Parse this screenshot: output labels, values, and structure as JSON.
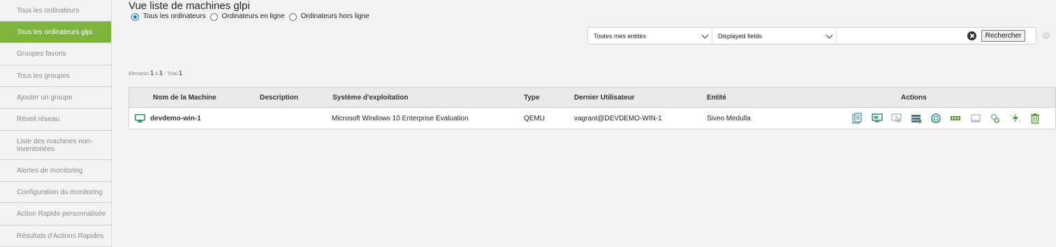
{
  "sidebar": {
    "items": [
      {
        "label": "Tous les ordinateurs",
        "active": false
      },
      {
        "label": "Tous les ordinateurs glpi",
        "active": true
      },
      {
        "label": "Groupes favoris",
        "active": false
      },
      {
        "label": "Tous les groupes",
        "active": false
      },
      {
        "label": "Ajouter un groupe",
        "active": false
      },
      {
        "label": "Réveil réseau",
        "active": false
      },
      {
        "label": "Liste des machines non-inventoriées",
        "active": false
      },
      {
        "label": "Alertes de monitoring",
        "active": false
      },
      {
        "label": "Configuration du monitoring",
        "active": false
      },
      {
        "label": "Action Rapide personnalisée",
        "active": false
      },
      {
        "label": "Résultats d'Actions Rapides",
        "active": false
      }
    ]
  },
  "header": {
    "title": "Vue liste de machines glpi"
  },
  "filters": {
    "options": [
      {
        "label": "Tous les ordinateurs",
        "checked": true
      },
      {
        "label": "Ordinateurs en ligne",
        "checked": false
      },
      {
        "label": "Ordinateurs hors ligne",
        "checked": false
      }
    ]
  },
  "search": {
    "entity_select": "Toutes mes entités",
    "fields_select": "Displayed fields",
    "query": "",
    "button_label": "Rechercher"
  },
  "counter": {
    "prefix": "Elements",
    "from": "1",
    "middle": "à",
    "to": "1",
    "total_prefix": "- Total",
    "total": "1"
  },
  "table": {
    "columns": [
      "Nom de la Machine",
      "Description",
      "Système d'exploitation",
      "Type",
      "Dernier Utilisateur",
      "Entité",
      "Actions"
    ],
    "rows": [
      {
        "name": "devdemo-win-1",
        "description": "",
        "os": "Microsoft Windows 10 Enterprise Evaluation",
        "type": "QEMU",
        "last_user": "vagrant@DEVDEMO-WIN-1",
        "entity": "Siveo Medulla",
        "actions": [
          "inventory-icon",
          "remote-desktop-icon",
          "vnc-icon",
          "backup-icon",
          "software-icon",
          "network-icon",
          "hardware-icon",
          "console-icon",
          "config-icon",
          "quick-action-icon",
          "delete-icon"
        ]
      }
    ]
  },
  "colors": {
    "accent": "#7db53c",
    "icon_teal": "#2e8b8b",
    "icon_green": "#4d9c2e"
  }
}
